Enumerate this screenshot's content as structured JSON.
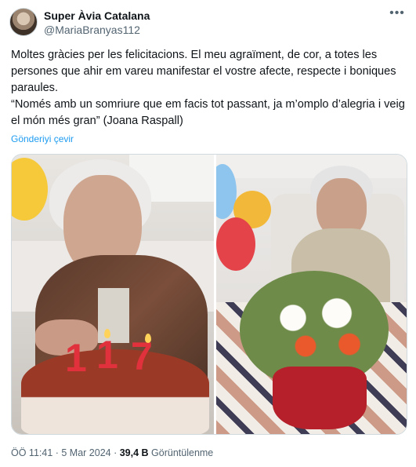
{
  "author": {
    "display_name": "Super Àvia Catalana",
    "handle": "@MariaBranyas112"
  },
  "more_icon": "more-horizontal-icon",
  "tweet": {
    "text": "Moltes gràcies per les felicitacions. El meu agraïment, de cor, a totes les persones que ahir em vareu manifestar el vostre afecte, respecte i boniques paraules.\n“Només amb un somriure que em facis tot passant, ja m’omplo d’alegria i veig el món més gran” (Joana Raspall)",
    "translate_label": "Gönderiyi çevir"
  },
  "media": {
    "candles": [
      "1",
      "1",
      "7"
    ],
    "colors": {
      "balloon_yellow": "#f5c93a",
      "balloon_blue": "#8ec5ee",
      "balloon_red": "#e4434a",
      "candle_red": "#e0313d",
      "cake_top": "#9a3a26"
    }
  },
  "footer": {
    "timestamp": "ÖÖ 11:41 · 5 Mar 2024 · ",
    "views_count": "39,4 B",
    "views_label": " Görüntülenme"
  }
}
